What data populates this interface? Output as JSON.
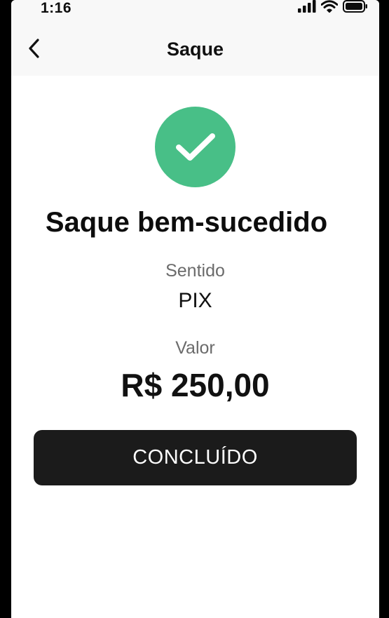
{
  "status_bar": {
    "time": "1:16",
    "icons": [
      "signal-icon",
      "wifi-icon",
      "battery-icon"
    ]
  },
  "nav": {
    "title": "Saque",
    "back_icon": "chevron-left-icon"
  },
  "result": {
    "icon": "check-circle-icon",
    "headline": "Saque bem-sucedido",
    "direction_label": "Sentido",
    "direction_value": "PIX",
    "amount_label": "Valor",
    "amount_value": "R$ 250,00"
  },
  "actions": {
    "done_label": "CONCLUÍDO"
  },
  "colors": {
    "success": "#48bf87",
    "button": "#1b1b1b",
    "text": "#111111",
    "muted": "#6b6b6b",
    "header_bg": "#f8f8f8"
  }
}
